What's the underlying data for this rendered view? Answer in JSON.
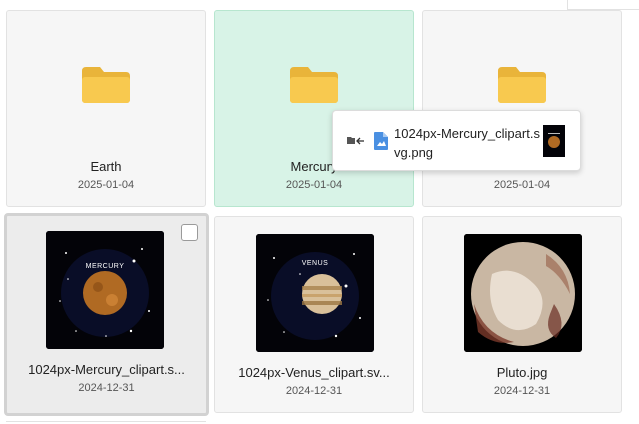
{
  "folders": [
    {
      "name": "Earth",
      "date": "2025-01-04"
    },
    {
      "name": "Mercury",
      "date": "2025-01-04"
    },
    {
      "name": "",
      "date": "2025-01-04"
    }
  ],
  "files": [
    {
      "name": "1024px-Mercury_clipart.s...",
      "date": "2024-12-31",
      "thumb_label": "MERCURY"
    },
    {
      "name": "1024px-Venus_clipart.sv...",
      "date": "2024-12-31",
      "thumb_label": "VENUS"
    },
    {
      "name": "Pluto.jpg",
      "date": "2024-12-31"
    }
  ],
  "drag_chip": {
    "file_name": "1024px-Mercury_clipart.svg.png"
  },
  "colors": {
    "folder": "#f8c94f",
    "drop_target": "#d8f3e7",
    "selected_border": "#d2d2d2",
    "file_icon": "#4a90e2"
  }
}
